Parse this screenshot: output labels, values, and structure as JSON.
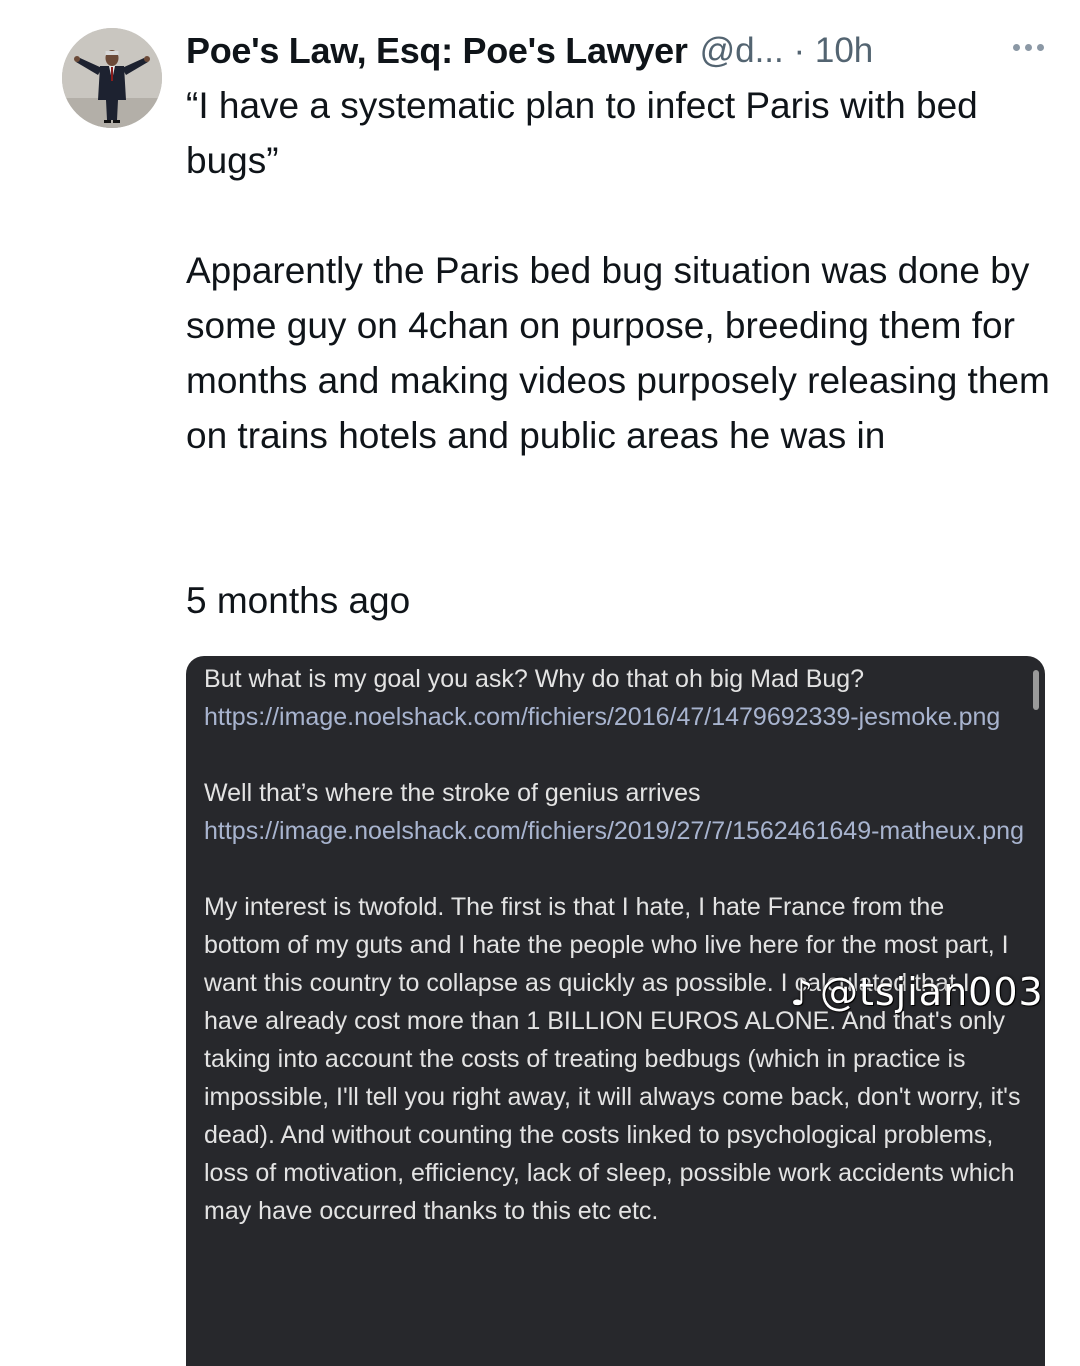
{
  "tweet": {
    "display_name": "Poe's Law, Esq: Poe's Lawyer",
    "handle_time": "@d... · 10h",
    "quote": "“I have a systematic plan to infect Paris with bed bugs”",
    "body": "Apparently the Paris bed bug situation was done by some guy on 4chan on purpose, breeding them for months and making videos purposely releasing them on trains hotels and public areas he was in",
    "timestamp": "5 months ago"
  },
  "embedded_post": {
    "line1": "But what is my goal you ask? Why do that oh big Mad Bug?",
    "link1": "https://image.noelshack.com/fichiers/2016/47/1479692339-jesmoke.png",
    "line2": "Well that’s where the stroke of genius arrives",
    "link2": "https://image.noelshack.com/fichiers/2019/27/7/1562461649-matheux.png",
    "para3": "My interest is twofold. The first is that I hate, I hate France from the bottom of my guts and I hate the people who live here for the most part, I want this country to collapse as quickly as possible. I calculated that I have already cost more than 1 BILLION EUROS ALONE. And that's only taking into account the costs of treating bedbugs (which in practice is impossible, I'll tell you right away, it will always come back, don't worry, it's dead). And without counting the costs linked to psychological problems, loss of motivation, efficiency, lack of sleep, possible work accidents which may have occurred thanks to this etc etc."
  },
  "watermark": {
    "icon": "tiktok-icon",
    "text": "@tsjian003"
  }
}
